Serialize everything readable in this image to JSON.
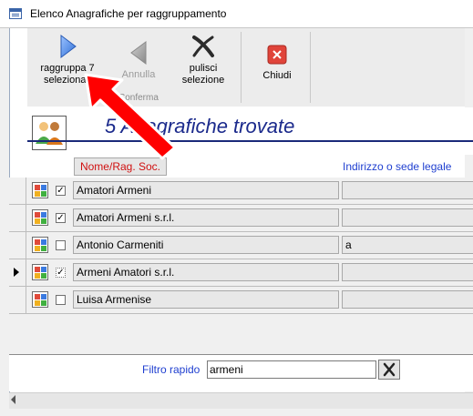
{
  "window": {
    "title": "Elenco Anagrafiche per raggruppamento"
  },
  "ribbon": {
    "group_label": "Conferma",
    "buttons": [
      {
        "label_line1": "raggruppa 7",
        "label_line2": "selezionati",
        "icon": "play-right-icon",
        "enabled": true
      },
      {
        "label_line1": "Annulla",
        "label_line2": "",
        "icon": "play-left-icon",
        "enabled": false
      },
      {
        "label_line1": "pulisci",
        "label_line2": "selezione",
        "icon": "clear-x-icon",
        "enabled": true
      },
      {
        "label_line1": "Chiudi",
        "label_line2": "",
        "icon": "close-red-icon",
        "enabled": true
      }
    ]
  },
  "header": {
    "title": "5 Anagrafiche trovate"
  },
  "columns": {
    "name": "Nome/Rag. Soc.",
    "address": "Indirizzo o sede legale"
  },
  "rows": [
    {
      "name": "Amatori Armeni",
      "address": "",
      "checked": true,
      "current": false
    },
    {
      "name": "Amatori Armeni s.r.l.",
      "address": "",
      "checked": true,
      "current": false
    },
    {
      "name": "Antonio Carmeniti",
      "address": "a",
      "checked": false,
      "current": false
    },
    {
      "name": "Armeni Amatori s.r.l.",
      "address": "",
      "checked": "partial",
      "current": true
    },
    {
      "name": "Luisa Armenise",
      "address": "",
      "checked": false,
      "current": false
    }
  ],
  "filter": {
    "label": "Filtro rapido",
    "value": "armeni"
  },
  "colors": {
    "accent_blue": "#1b2a8c",
    "red_arrow": "#ff0000",
    "header_red": "#d01010"
  }
}
